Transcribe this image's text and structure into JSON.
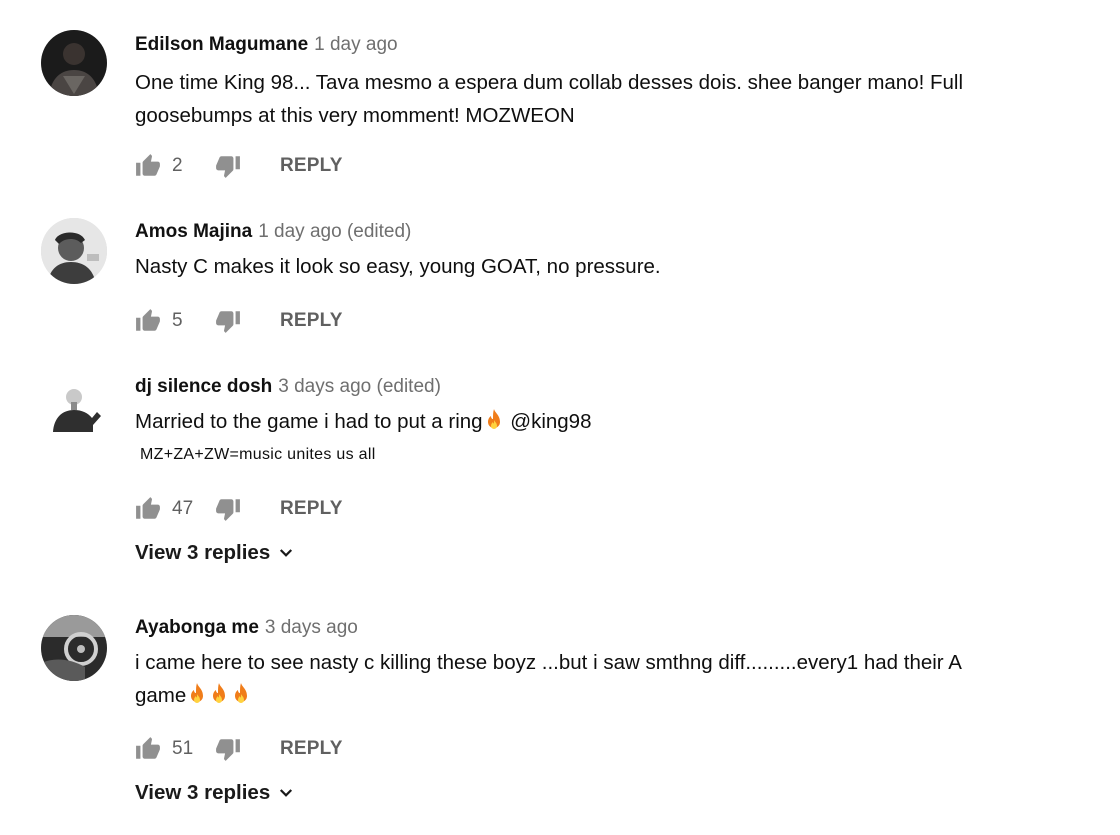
{
  "comments": [
    {
      "author": "Edilson Magumane",
      "time": "1 day ago",
      "lines": [
        "One time King 98... Tava mesmo a espera dum collab desses dois. shee banger mano! Full",
        "goosebumps at this very momment!  MOZWEON"
      ],
      "likes": "2",
      "reply_label": "REPLY",
      "avatar_icon": "user-avatar-dark"
    },
    {
      "author": "Amos Majina",
      "time": "1 day ago (edited)",
      "lines": [
        "Nasty C makes it look so easy, young GOAT, no pressure."
      ],
      "likes": "5",
      "reply_label": "REPLY",
      "avatar_icon": "user-avatar-gray"
    },
    {
      "author": "dj silence dosh",
      "time": "3 days ago (edited)",
      "line1": "Married to the game i had to put a ring",
      "line1_tail": " @king98",
      "line2": "MZ+ZA+ZW=music unites us all",
      "likes": "47",
      "reply_label": "REPLY",
      "view_replies": "View 3 replies",
      "avatar_icon": "user-avatar-white"
    },
    {
      "author": "Ayabonga me",
      "time": "3 days ago",
      "line1": "i came here to see nasty c killing these boyz ...but i saw smthng diff.........every1 had their A",
      "line2": "game",
      "likes": "51",
      "reply_label": "REPLY",
      "view_replies": "View 3 replies",
      "avatar_icon": "user-avatar-car"
    }
  ],
  "icons": {
    "like": "thumbs-up-icon",
    "dislike": "thumbs-down-icon",
    "expand": "chevron-down-icon",
    "emoji": "fire-emoji"
  },
  "colors": {
    "author": "#111111",
    "muted": "#606060",
    "fire_outer": "#f07d1a",
    "fire_inner": "#ffd23f"
  }
}
